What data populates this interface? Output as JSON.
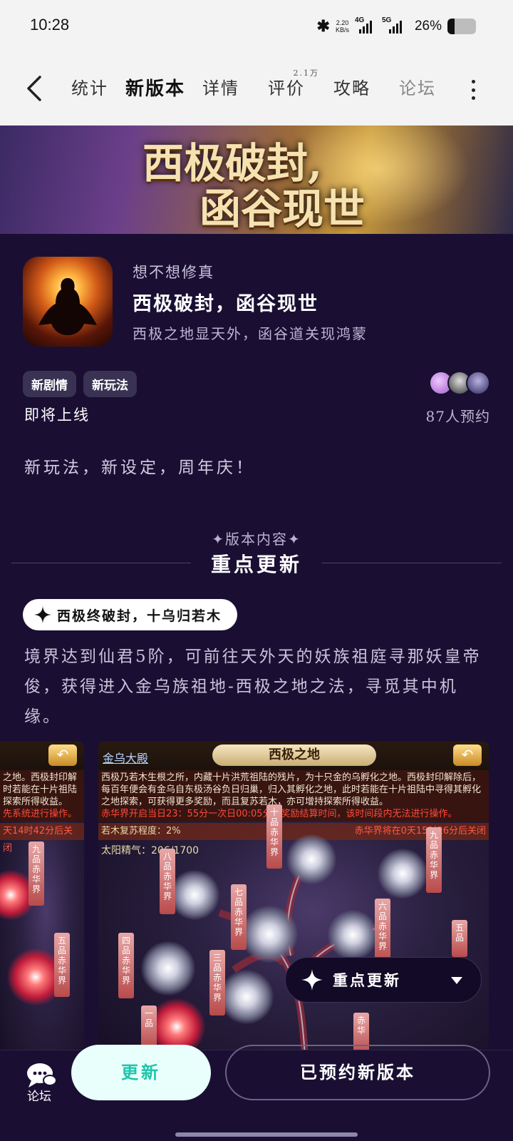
{
  "status": {
    "time": "10:28",
    "speed_value": "2.20",
    "speed_unit": "KB/s",
    "net1": "4G",
    "net2": "5G",
    "battery": "26%",
    "battery_level": 0.26
  },
  "nav": {
    "tabs": [
      {
        "label": "统计"
      },
      {
        "label": "新版本"
      },
      {
        "label": "详情"
      },
      {
        "label": "评价",
        "badge": "2.1万"
      },
      {
        "label": "攻略"
      },
      {
        "label": "论坛"
      }
    ]
  },
  "banner": {
    "line1": "西极破封,",
    "line2": "函谷现世"
  },
  "app": {
    "name": "想不想修真",
    "title": "西极破封，函谷现世",
    "desc": "西极之地显天外，函谷道关现鸿蒙",
    "tags": [
      "新剧情",
      "新玩法"
    ],
    "release": "即将上线",
    "reserve_count": "87人预约",
    "slogan": "新玩法，新设定，周年庆！"
  },
  "section": {
    "label": "版本内容",
    "title": "重点更新",
    "pill": "西极终破封，十乌归若木",
    "para": "境界达到仙君5阶，可前往天外天的妖族祖庭寻那妖皇帝俊，获得进入金乌族祖地-西极之地之法，寻觅其中机缘。"
  },
  "shot_left": {
    "text1": "之地。西极封印解",
    "text2": "时若能在十片祖陆",
    "text3": "探索所得收益。",
    "warn": "先系统进行操作。",
    "bar": "天14时42分后关闭",
    "ribbon1": "九品赤华界",
    "ribbon2": "五品赤华界"
  },
  "shot_main": {
    "hall": "金乌大殿",
    "title": "西极之地",
    "text": "西极乃若木生根之所，内藏十片洪荒祖陆的残片，为十只金的乌孵化之地。西极封印解除后，每百年便会有金乌自东极汤谷负日归巢，归入其孵化之地，此时若能在十片祖陆中寻得其孵化之地探索，可获得更多奖励，而且复苏若木，亦可增持探索所得收益。",
    "warn": "赤华界开启当日23：55分一次日00:05分为奖励结算时间，该时间段内无法进行操作。",
    "bar_left": "若木复苏程度：2%",
    "bar_right": "赤华界将在0天15时26分后关闭",
    "sun": "太阳精气：206/1700",
    "ribbons": [
      "十品赤华界",
      "八品赤华界",
      "七品赤华界",
      "九品赤华界",
      "六品赤华界",
      "四品赤华界",
      "三品赤华界",
      "五品",
      "一品",
      "赤华"
    ]
  },
  "float_button": "重点更新",
  "bottom": {
    "forum": "论坛",
    "update": "更新",
    "reserved": "已预约新版本"
  }
}
